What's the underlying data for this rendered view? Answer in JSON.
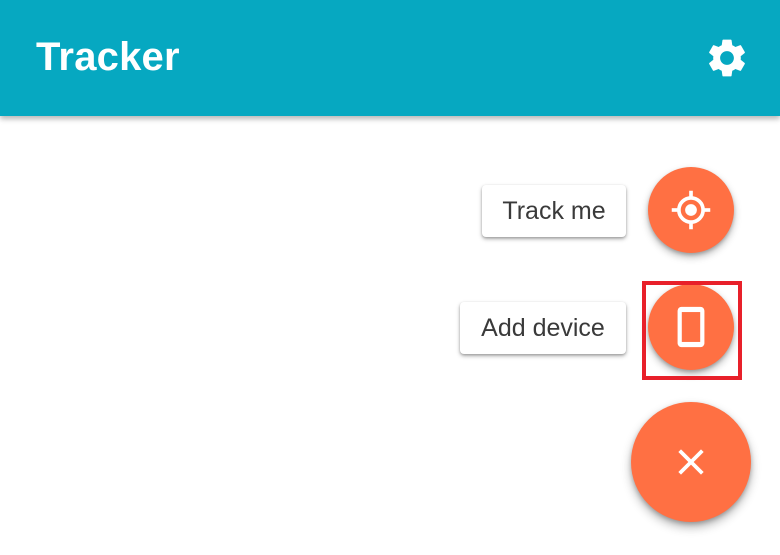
{
  "appbar": {
    "title": "Tracker",
    "background_color": "#06a8c1",
    "settings_icon": "gear-icon"
  },
  "speed_dial": {
    "accent_color": "#ff7043",
    "actions": [
      {
        "label": "Track me",
        "icon": "crosshair-icon"
      },
      {
        "label": "Add device",
        "icon": "smartphone-icon"
      }
    ],
    "main_icon": "close-icon"
  },
  "highlight": {
    "color": "#e8202a",
    "target": "Add device"
  }
}
